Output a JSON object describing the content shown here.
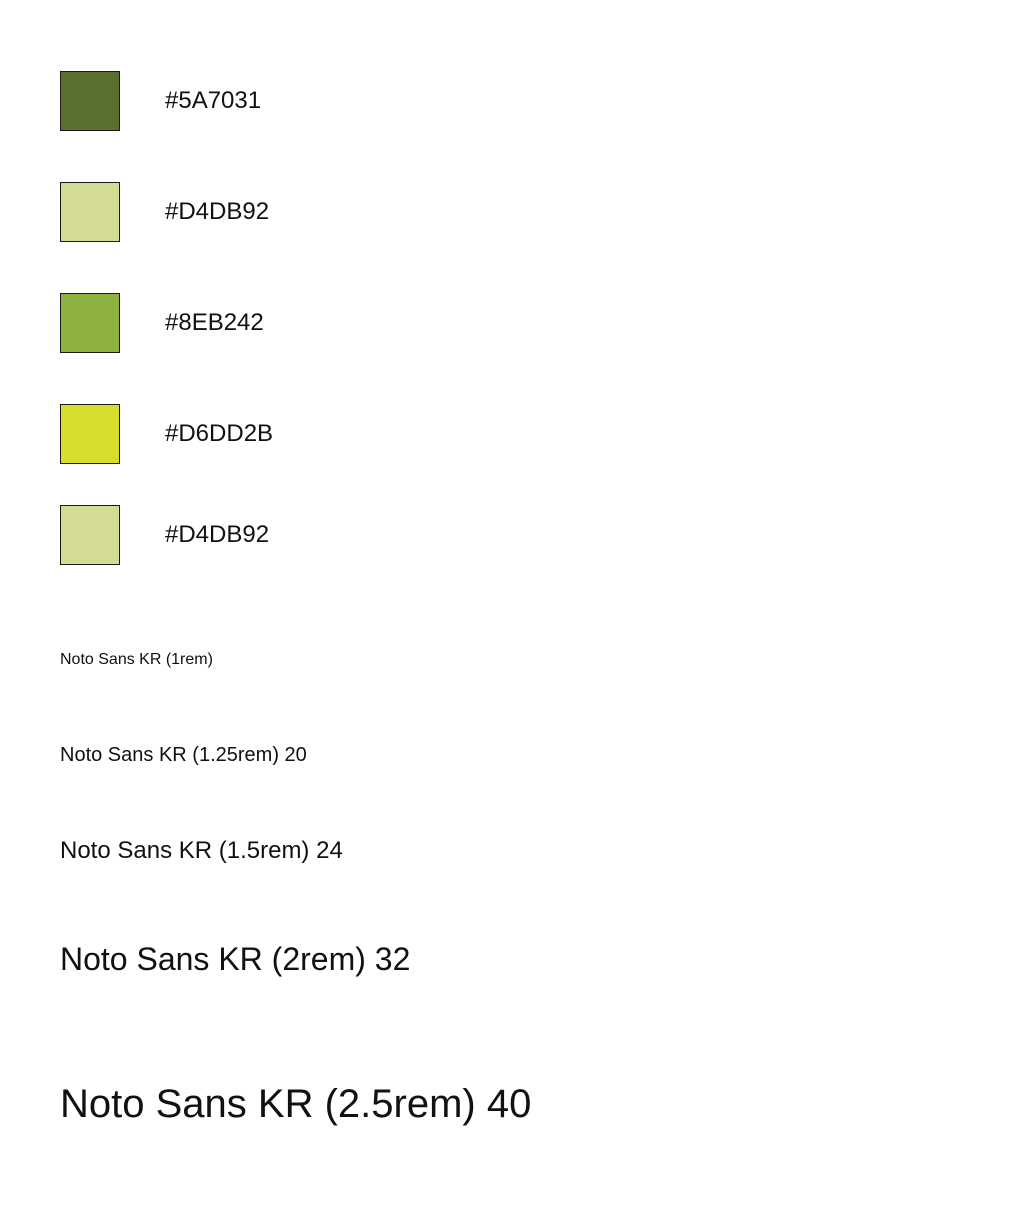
{
  "palette": {
    "swatches": [
      {
        "hex": "#5A7031",
        "color": "#5A7031"
      },
      {
        "hex": "#D4DB92",
        "color": "#D4DB92"
      },
      {
        "hex": "#8EB242",
        "color": "#8EB242"
      },
      {
        "hex": "#D6DD2B",
        "color": "#D6DD2B"
      },
      {
        "hex": "#D4DB92",
        "color": "#D4DB92"
      }
    ]
  },
  "typography": {
    "samples": [
      "Noto Sans KR (1rem)",
      "Noto Sans KR (1.25rem) 20",
      "Noto Sans KR (1.5rem) 24",
      "Noto Sans KR (2rem) 32",
      "Noto Sans KR (2.5rem) 40"
    ]
  }
}
